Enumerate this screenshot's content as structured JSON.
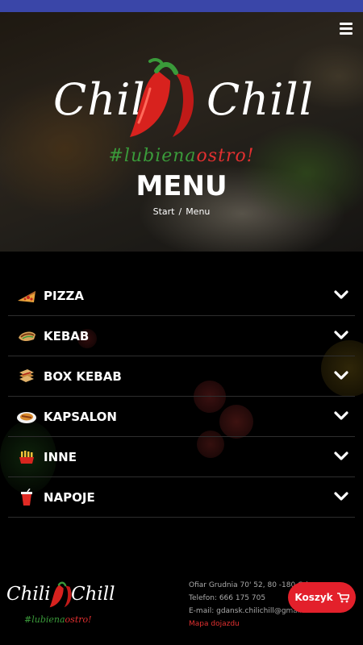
{
  "header": {
    "menu_icon": "hamburger-icon",
    "logo": {
      "left_word": "Chili",
      "right_word": "Chill"
    },
    "hashtag": {
      "part1": "#lubie",
      "part2": "na",
      "part3": "ostro!"
    },
    "title": "MENU",
    "breadcrumb": {
      "home": "Start",
      "separator": "/",
      "current": "Menu"
    }
  },
  "menu": {
    "items": [
      {
        "label": "PIZZA",
        "icon": "pizza-icon"
      },
      {
        "label": "KEBAB",
        "icon": "kebab-icon"
      },
      {
        "label": "BOX KEBAB",
        "icon": "box-kebab-icon"
      },
      {
        "label": "KAPSALON",
        "icon": "kapsalon-icon"
      },
      {
        "label": "INNE",
        "icon": "fries-icon"
      },
      {
        "label": "NAPOJE",
        "icon": "drink-icon"
      }
    ],
    "expand_icon": "chevron-down-icon"
  },
  "footer": {
    "logo": {
      "left_word": "Chili",
      "right_word": "Chill"
    },
    "hashtag": {
      "part1": "#lubie",
      "part2": "na",
      "part3": "ostro!"
    },
    "address": "Ofiar Grudnia 70' 52, 80 -180 Gd",
    "phone": "Telefon: 666 175 705",
    "email": "E-mail: gdansk.chilichill@gmail.",
    "map_link": "Mapa dojazdu"
  },
  "cart": {
    "label": "Koszyk",
    "icon": "cart-icon"
  },
  "colors": {
    "accent": "#e3202b",
    "topbar": "#3a46a8",
    "green": "#3a9a3a"
  }
}
